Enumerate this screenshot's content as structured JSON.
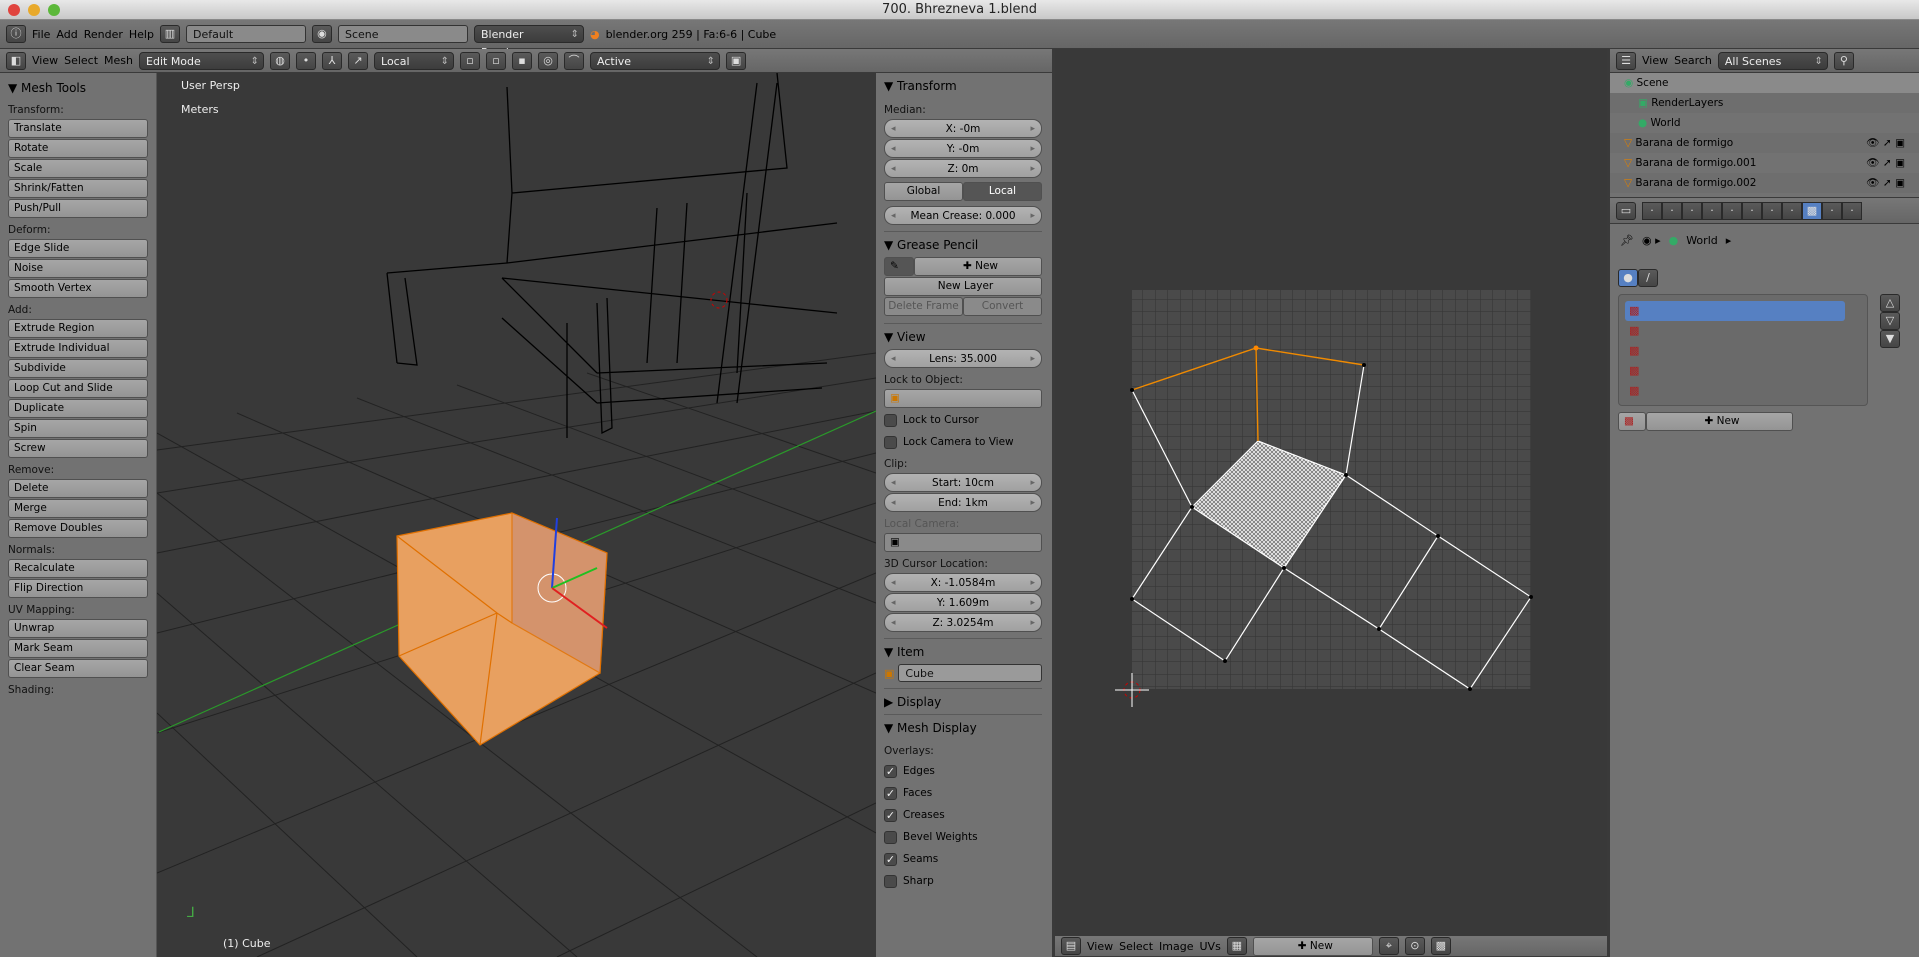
{
  "window": {
    "title": "700. Bhrezneva 1.blend"
  },
  "info_header": {
    "menus": [
      "File",
      "Add",
      "Render",
      "Help"
    ],
    "layout": "Default",
    "scene": "Scene",
    "engine": "Blender Render",
    "stats": "blender.org 259 | Fa:6-6 | Cube"
  },
  "view3d_header": {
    "menus": [
      "View",
      "Select",
      "Mesh"
    ],
    "mode": "Edit Mode",
    "orientation": "Local",
    "pivot_active": "Active"
  },
  "viewport": {
    "view_label": "User Persp",
    "units": "Meters",
    "object_label": "(1) Cube"
  },
  "toolshelf": {
    "title": "Mesh Tools",
    "groups": [
      {
        "label": "Transform:",
        "items": [
          "Translate",
          "Rotate",
          "Scale",
          "Shrink/Fatten",
          "Push/Pull"
        ]
      },
      {
        "label": "Deform:",
        "items": [
          "Edge Slide",
          "Noise",
          "Smooth Vertex"
        ]
      },
      {
        "label": "Add:",
        "items": [
          "Extrude Region",
          "Extrude Individual",
          "Subdivide",
          "Loop Cut and Slide",
          "Duplicate",
          "Spin",
          "Screw"
        ]
      },
      {
        "label": "Remove:",
        "items": [
          "Delete",
          "Merge",
          "Remove Doubles"
        ]
      },
      {
        "label": "Normals:",
        "items": [
          "Recalculate",
          "Flip Direction"
        ]
      },
      {
        "label": "UV Mapping:",
        "items": [
          "Unwrap",
          "Mark Seam",
          "Clear Seam"
        ]
      },
      {
        "label": "Shading:",
        "items": []
      }
    ]
  },
  "npanel": {
    "transform": {
      "title": "Transform",
      "median": "Median:",
      "x": "X: -0m",
      "y": "Y: -0m",
      "z": "Z: 0m",
      "global": "Global",
      "local": "Local",
      "crease": "Mean Crease: 0.000"
    },
    "grease": {
      "title": "Grease Pencil",
      "new": "New",
      "new_layer": "New Layer",
      "delete_frame": "Delete Frame",
      "convert": "Convert"
    },
    "view": {
      "title": "View",
      "lens": "Lens: 35.000",
      "lock_object": "Lock to Object:",
      "lock_cursor": "Lock to Cursor",
      "lock_camera": "Lock Camera to View",
      "clip": "Clip:",
      "start": "Start: 10cm",
      "end": "End: 1km",
      "local_camera": "Local Camera:",
      "cursor_loc": "3D Cursor Location:",
      "cx": "X: -1.0584m",
      "cy": "Y: 1.609m",
      "cz": "Z: 3.0254m"
    },
    "item": {
      "title": "Item",
      "name": "Cube"
    },
    "display": {
      "title": "Display"
    },
    "mesh_display": {
      "title": "Mesh Display",
      "overlays": "Overlays:",
      "options": [
        {
          "label": "Edges",
          "checked": true
        },
        {
          "label": "Faces",
          "checked": true
        },
        {
          "label": "Creases",
          "checked": true
        },
        {
          "label": "Bevel Weights",
          "checked": false
        },
        {
          "label": "Seams",
          "checked": true
        },
        {
          "label": "Sharp",
          "checked": false
        }
      ]
    }
  },
  "uv_header": {
    "menus": [
      "View",
      "Select",
      "Image",
      "UVs"
    ],
    "new": "New"
  },
  "outliner": {
    "menus": [
      "View",
      "Search"
    ],
    "filter": "All Scenes",
    "rows": [
      {
        "label": "Scene",
        "icon": "scene-icon",
        "indent": 0
      },
      {
        "label": "RenderLayers",
        "icon": "renderlayers-icon",
        "indent": 1
      },
      {
        "label": "World",
        "icon": "world-icon",
        "indent": 1
      },
      {
        "label": "Barana de formigo",
        "icon": "mesh-icon",
        "indent": 0
      },
      {
        "label": "Barana de formigo.001",
        "icon": "mesh-icon",
        "indent": 0
      },
      {
        "label": "Barana de formigo.002",
        "icon": "mesh-icon",
        "indent": 0
      }
    ]
  },
  "properties": {
    "breadcrumb": "World",
    "new": "New",
    "texture_slots": 5,
    "accent": "#5680c2"
  }
}
